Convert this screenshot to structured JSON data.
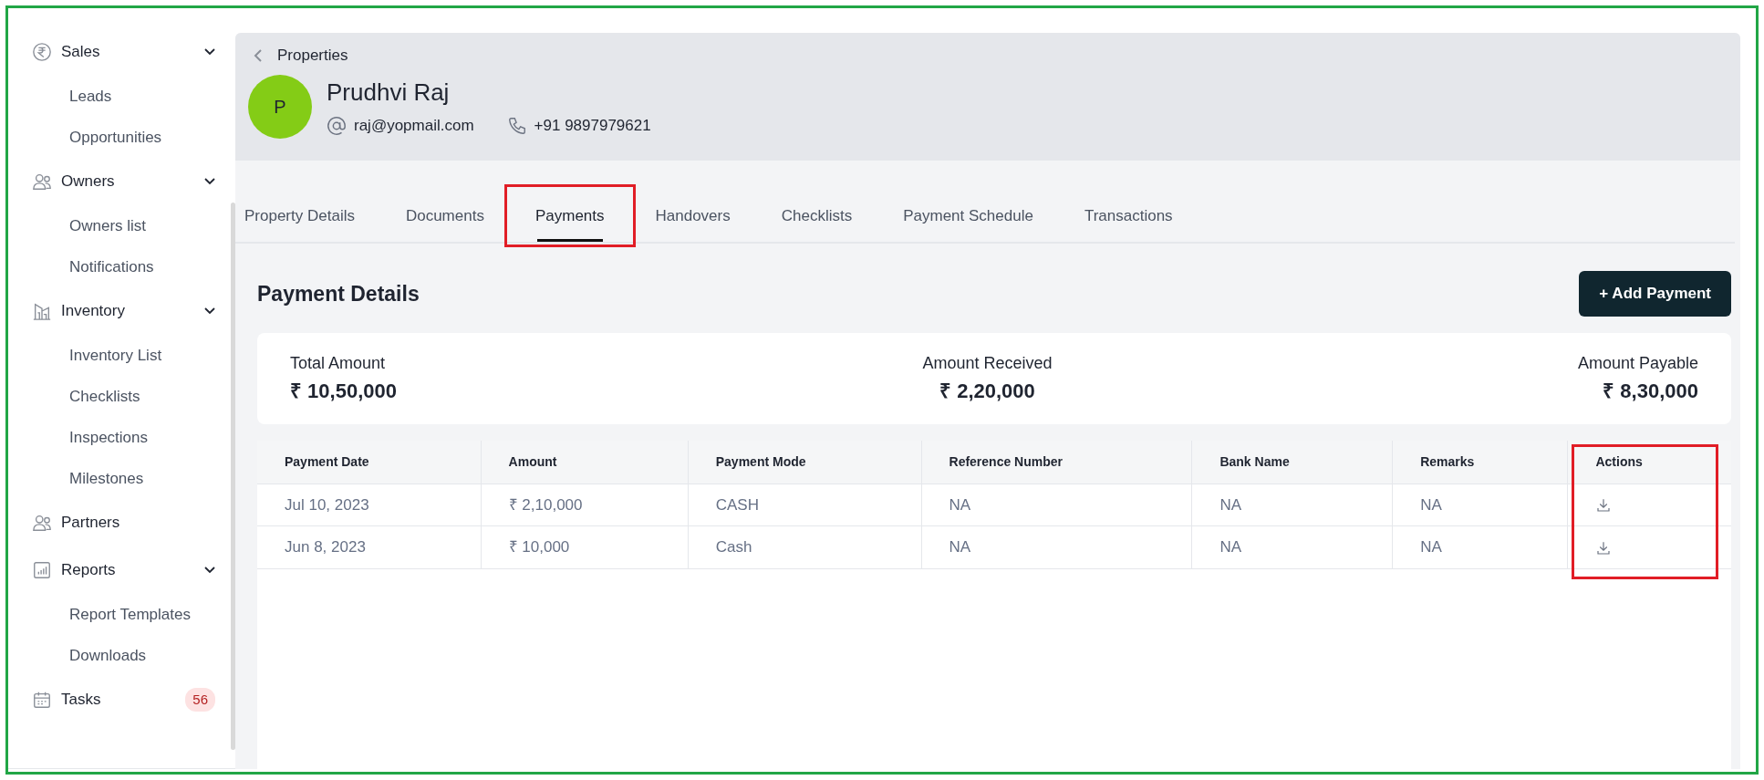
{
  "sidebar": {
    "items": [
      {
        "label": "Sales",
        "expanded": true,
        "children": [
          {
            "label": "Leads"
          },
          {
            "label": "Opportunities"
          }
        ]
      },
      {
        "label": "Owners",
        "expanded": true,
        "children": [
          {
            "label": "Owners list"
          },
          {
            "label": "Notifications"
          }
        ]
      },
      {
        "label": "Inventory",
        "expanded": true,
        "children": [
          {
            "label": "Inventory List"
          },
          {
            "label": "Checklists"
          },
          {
            "label": "Inspections"
          },
          {
            "label": "Milestones"
          }
        ]
      },
      {
        "label": "Partners"
      },
      {
        "label": "Reports",
        "expanded": true,
        "children": [
          {
            "label": "Report Templates"
          },
          {
            "label": "Downloads"
          }
        ]
      },
      {
        "label": "Tasks",
        "badge": "56"
      }
    ]
  },
  "breadcrumb": "Properties",
  "profile": {
    "initial": "P",
    "name": "Prudhvi Raj",
    "email": "raj@yopmail.com",
    "phone": "+91 9897979621"
  },
  "tabs": [
    {
      "label": "Property Details",
      "selected": false,
      "highlighted": false
    },
    {
      "label": "Documents",
      "selected": false,
      "highlighted": false
    },
    {
      "label": "Payments",
      "selected": true,
      "highlighted": true
    },
    {
      "label": "Handovers",
      "selected": false,
      "highlighted": false
    },
    {
      "label": "Checklists",
      "selected": false,
      "highlighted": false
    },
    {
      "label": "Payment Schedule",
      "selected": false,
      "highlighted": false
    },
    {
      "label": "Transactions",
      "selected": false,
      "highlighted": false
    }
  ],
  "section_title": "Payment Details",
  "add_button": "+ Add Payment",
  "summary": [
    {
      "label": "Total Amount",
      "value": "₹ 10,50,000"
    },
    {
      "label": "Amount Received",
      "value": "₹ 2,20,000"
    },
    {
      "label": "Amount Payable",
      "value": "₹ 8,30,000"
    }
  ],
  "table": {
    "columns": [
      {
        "label": "Payment Date",
        "highlighted": false
      },
      {
        "label": "Amount",
        "highlighted": false
      },
      {
        "label": "Payment Mode",
        "highlighted": false
      },
      {
        "label": "Reference Number",
        "highlighted": false
      },
      {
        "label": "Bank Name",
        "highlighted": false
      },
      {
        "label": "Remarks",
        "highlighted": false
      },
      {
        "label": "Actions",
        "highlighted": true
      }
    ],
    "rows": [
      [
        "Jul 10, 2023",
        "₹ 2,10,000",
        "CASH",
        "NA",
        "NA",
        "NA"
      ],
      [
        "Jun 8, 2023",
        "₹ 10,000",
        "Cash",
        "NA",
        "NA",
        "NA"
      ]
    ]
  }
}
